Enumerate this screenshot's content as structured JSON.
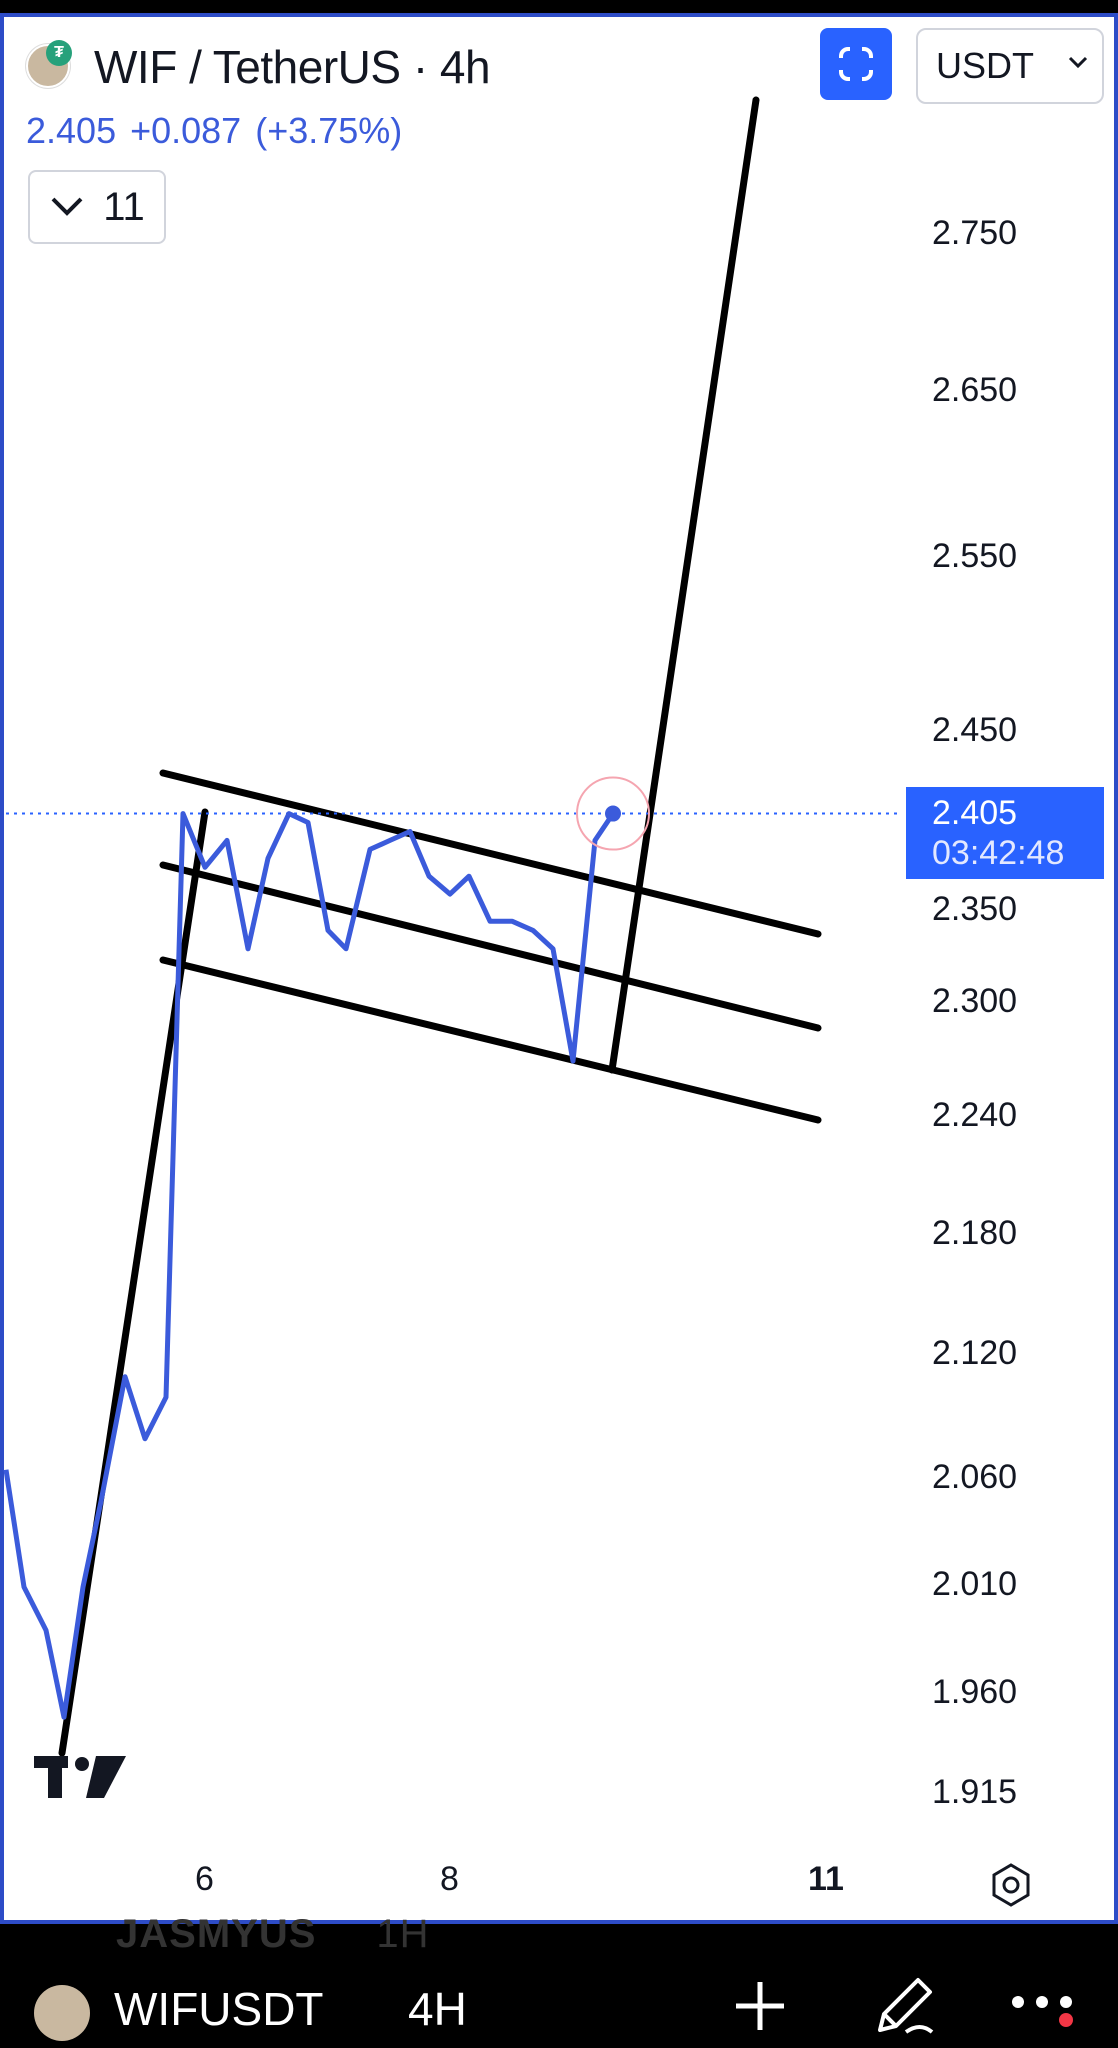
{
  "header": {
    "title": "WIF / TetherUS · 4h",
    "last_price": "2.405",
    "change": "+0.087",
    "change_pct": "(+3.75%)",
    "indicators_count": "11",
    "currency": "USDT"
  },
  "price_tag": {
    "price": "2.405",
    "countdown": "03:42:48"
  },
  "bottom_bar": {
    "symbol": "WIFUSDT",
    "interval": "4H"
  },
  "ghost_text": {
    "symbol": "JASMYUS",
    "interval": "1H"
  },
  "colors": {
    "line": "#3b5bdb",
    "accent": "#2962ff",
    "drawing": "#000000",
    "frame": "#2d4cc7"
  },
  "chart_data": {
    "type": "line",
    "symbol": "WIF / TetherUS",
    "interval": "4h",
    "y_ticks": [
      "2.750",
      "2.650",
      "2.550",
      "2.450",
      "2.350",
      "2.300",
      "2.240",
      "2.180",
      "2.120",
      "2.060",
      "2.010",
      "1.960",
      "1.915"
    ],
    "x_ticks": [
      "6",
      "8",
      "11"
    ],
    "ylim": [
      1.9,
      2.8
    ],
    "series": [
      {
        "values": [
          2.065,
          2.01,
          1.99,
          1.95,
          2.01,
          2.05,
          2.11,
          2.08,
          2.1,
          2.405,
          2.375,
          2.39,
          2.33,
          2.38,
          2.405,
          2.4,
          2.34,
          2.33,
          2.385,
          2.39,
          2.395,
          2.37,
          2.36,
          2.37,
          2.345,
          2.345,
          2.34,
          2.33,
          2.27,
          2.39,
          2.405
        ]
      }
    ],
    "current_price": 2.405,
    "drawings": [
      {
        "type": "trendline",
        "desc": "impulse pole"
      },
      {
        "type": "parallel_channel",
        "desc": "descending flag with midline"
      },
      {
        "type": "trendline",
        "desc": "breakout projection"
      }
    ],
    "grid": false,
    "legend": "none"
  }
}
